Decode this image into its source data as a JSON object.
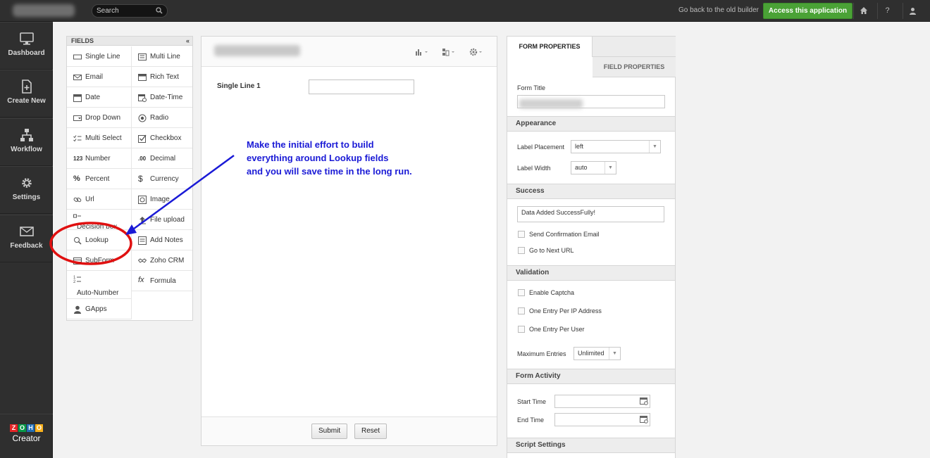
{
  "topbar": {
    "search_placeholder": "Search",
    "old_builder_link": "Go back to the old builder",
    "access_button": "Access this application",
    "help_label": "?"
  },
  "nav": {
    "items": [
      {
        "label": "Dashboard",
        "icon": "monitor-icon"
      },
      {
        "label": "Create New",
        "icon": "new-document-icon"
      },
      {
        "label": "Workflow",
        "icon": "workflow-icon"
      },
      {
        "label": "Settings",
        "icon": "gear-icon"
      },
      {
        "label": "Feedback",
        "icon": "envelope-icon"
      }
    ],
    "brand_letters": [
      "Z",
      "O",
      "H",
      "O"
    ],
    "brand_colors": [
      "#e42527",
      "#089949",
      "#226db4",
      "#f9b21d"
    ],
    "brand_name": "Creator"
  },
  "fields_panel": {
    "header": "FIELDS",
    "collapse": "«",
    "left": [
      "Single Line",
      "Email",
      "Date",
      "Drop Down",
      "Multi Select",
      "Number",
      "Percent",
      "Url",
      "Decision box",
      "Lookup",
      "SubForm",
      "Auto-Number",
      "GApps"
    ],
    "right": [
      "Multi Line",
      "Rich Text",
      "Date-Time",
      "Radio",
      "Checkbox",
      "Decimal",
      "Currency",
      "Image",
      "File upload",
      "Add Notes",
      "Zoho CRM",
      "Formula"
    ],
    "number_glyph": "123",
    "decimal_glyph": ".00",
    "currency_glyph": "$",
    "percent_glyph": "%",
    "formula_glyph": "fx"
  },
  "form": {
    "field_label": "Single Line 1",
    "submit": "Submit",
    "reset": "Reset"
  },
  "annotation": {
    "line1": "Make the initial effort to build",
    "line2": "everything around Lookup fields",
    "line3": "and you will save time in the long run.",
    "color": "#1a1ad6",
    "circle_color": "#e01010"
  },
  "properties": {
    "tab_form": "FORM PROPERTIES",
    "tab_field": "FIELD PROPERTIES",
    "form_title_label": "Form Title",
    "appearance": {
      "header": "Appearance",
      "label_placement": "Label Placement",
      "label_placement_value": "left",
      "label_width": "Label Width",
      "label_width_value": "auto"
    },
    "success": {
      "header": "Success",
      "message": "Data Added SuccessFully!",
      "send_email": "Send Confirmation Email",
      "next_url": "Go to Next URL"
    },
    "validation": {
      "header": "Validation",
      "captcha": "Enable Captcha",
      "per_ip": "One Entry Per IP Address",
      "per_user": "One Entry Per User",
      "max_entries": "Maximum Entries",
      "max_entries_value": "Unlimited"
    },
    "activity": {
      "header": "Form Activity",
      "start": "Start Time",
      "end": "End Time"
    },
    "script_settings": "Script Settings"
  }
}
